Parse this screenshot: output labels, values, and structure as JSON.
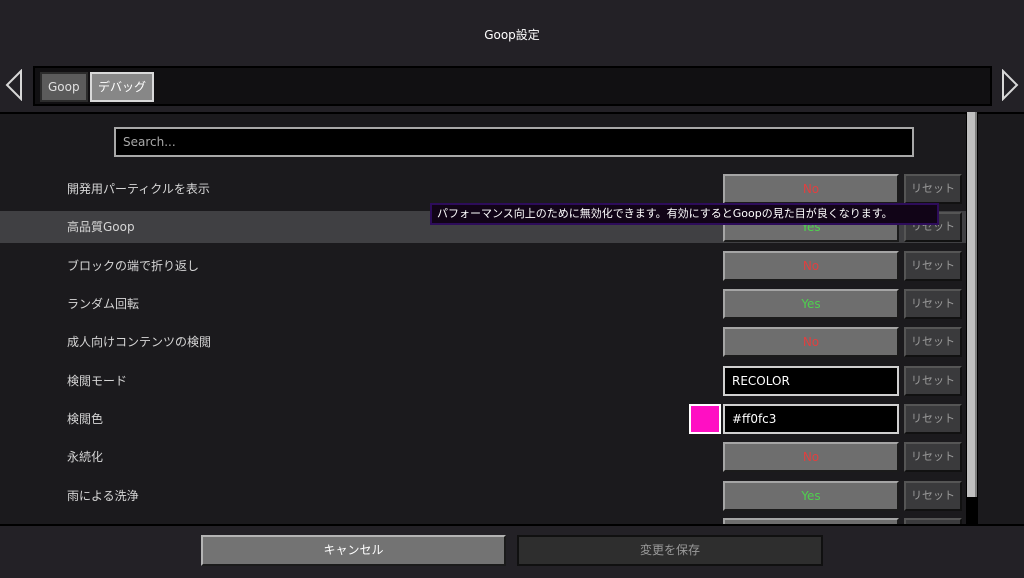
{
  "window": {
    "title": "Goop設定"
  },
  "tabs": [
    {
      "label": "Goop",
      "selected": false
    },
    {
      "label": "デバッグ",
      "selected": true
    }
  ],
  "search": {
    "placeholder": "Search..."
  },
  "settings": [
    {
      "label": "開発用パーティクルを表示",
      "control": "toggle",
      "value": "No"
    },
    {
      "label": "高品質Goop",
      "control": "toggle",
      "value": "Yes",
      "highlighted": true
    },
    {
      "label": "ブロックの端で折り返し",
      "control": "toggle",
      "value": "No"
    },
    {
      "label": "ランダム回転",
      "control": "toggle",
      "value": "Yes"
    },
    {
      "label": "成人向けコンテンツの検閲",
      "control": "toggle",
      "value": "No"
    },
    {
      "label": "検閲モード",
      "control": "text",
      "value": "RECOLOR"
    },
    {
      "label": "検閲色",
      "control": "color",
      "value": "#ff0fc3",
      "swatch_color": "#ff0fc3"
    },
    {
      "label": "永続化",
      "control": "toggle",
      "value": "No"
    },
    {
      "label": "雨による洗浄",
      "control": "toggle",
      "value": "Yes"
    }
  ],
  "reset_label": "リセット",
  "tooltip": {
    "text": "パフォーマンス向上のために無効化できます。有効にするとGoopの見た目が良くなります。"
  },
  "footer": {
    "cancel_label": "キャンセル",
    "save_label": "変更を保存"
  },
  "colors": {
    "yes": "#4fd04f",
    "no": "#e04040",
    "background": "#232126",
    "tooltip_border": "#2d0c5a"
  },
  "icons": {
    "prev": "chevron-left-icon",
    "next": "chevron-right-icon"
  }
}
